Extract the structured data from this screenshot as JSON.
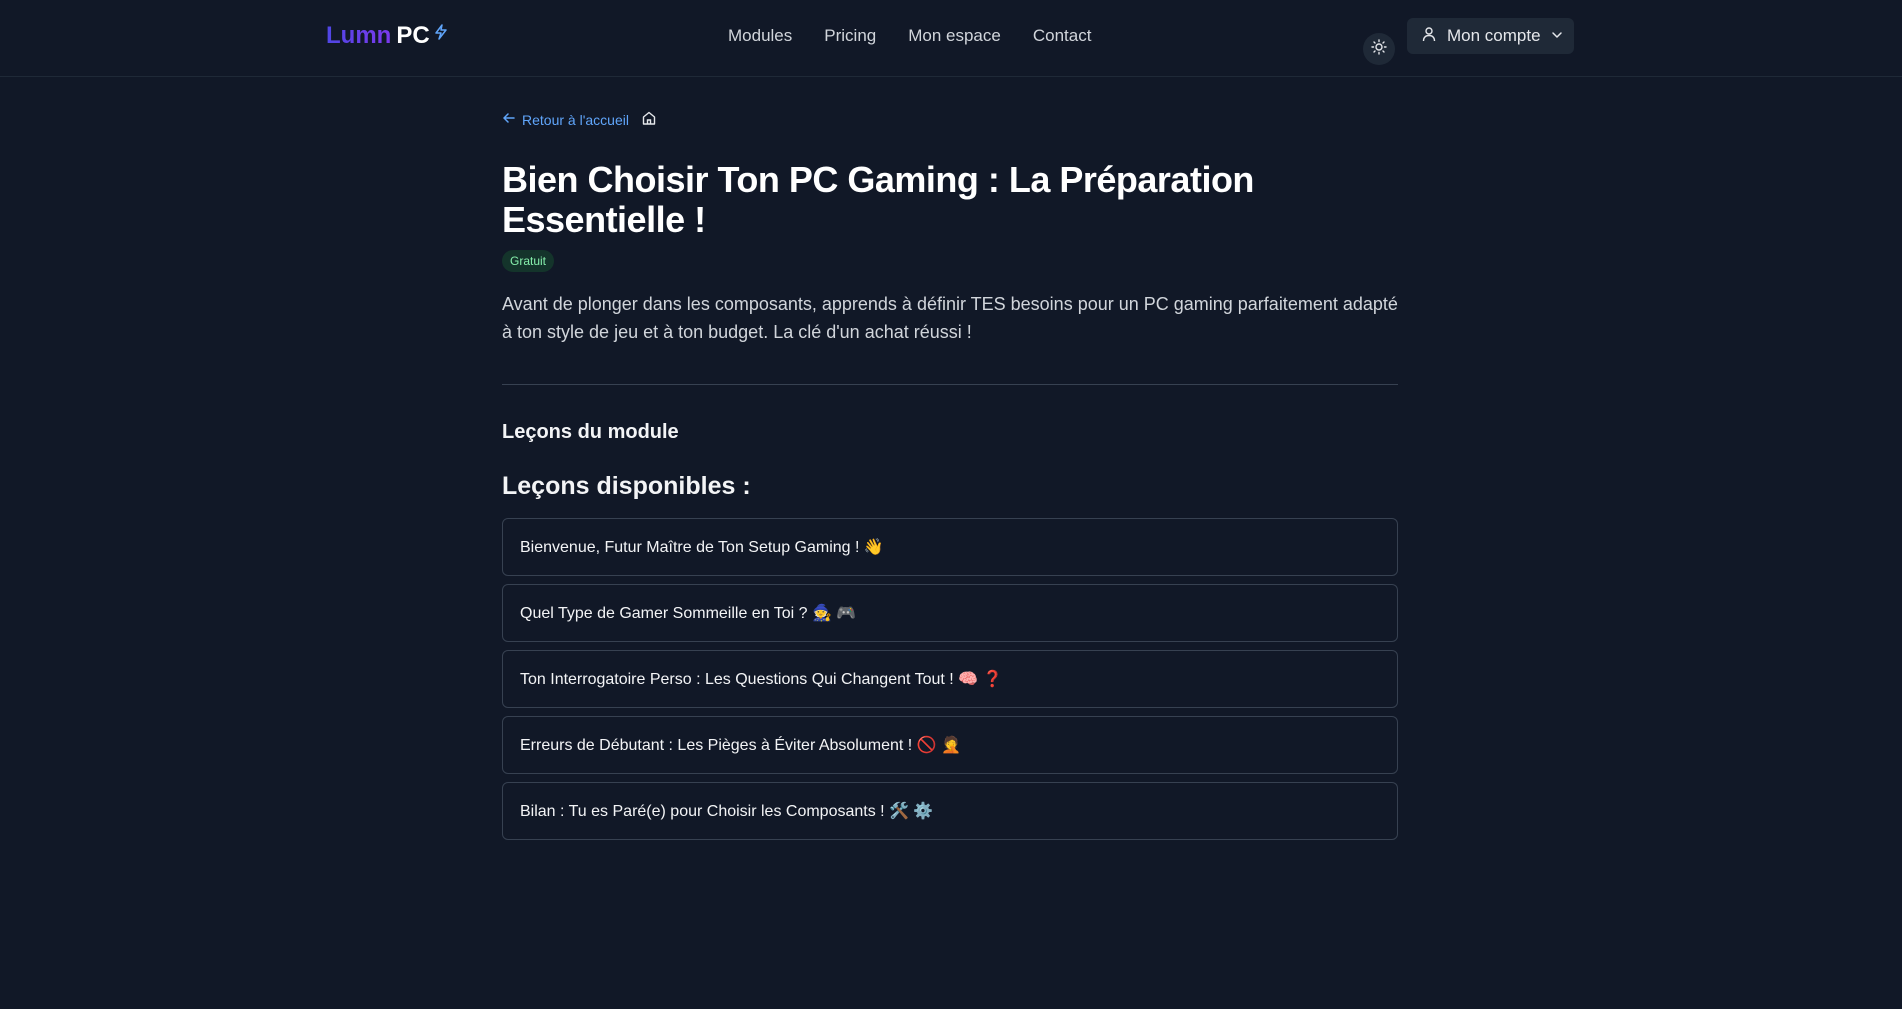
{
  "header": {
    "logo_part1": "Lumn",
    "logo_part2": "PC",
    "logo_icon": "lightning-bolt-icon",
    "nav": [
      "Modules",
      "Pricing",
      "Mon espace",
      "Contact"
    ],
    "theme_icon": "sun-icon",
    "account_label": "Mon compte"
  },
  "main": {
    "back_label": "Retour à l'accueil",
    "title": "Bien Choisir Ton PC Gaming : La Préparation Essentielle !",
    "badge": "Gratuit",
    "description": "Avant de plonger dans les composants, apprends à définir TES besoins pour un PC gaming parfaitement adapté à ton style de jeu et à ton budget. La clé d'un achat réussi !",
    "section_heading": "Leçons du module",
    "lessons_heading": "Leçons disponibles :",
    "lessons": [
      "Bienvenue, Futur Maître de Ton Setup Gaming ! 👋",
      "Quel Type de Gamer Sommeille en Toi ? 🧙 🎮",
      "Ton Interrogatoire Perso : Les Questions Qui Changent Tout ! 🧠 ❓",
      "Erreurs de Débutant : Les Pièges à Éviter Absolument ! 🚫 🤦",
      "Bilan : Tu es Paré(e) pour Choisir les Composants ! 🛠️ ⚙️"
    ]
  },
  "colors": {
    "background": "#111827",
    "accent_link": "#60a5fa",
    "logo_gradient_start": "#4f46e5",
    "logo_gradient_end": "#7c3aed",
    "badge_text": "#86efac"
  }
}
